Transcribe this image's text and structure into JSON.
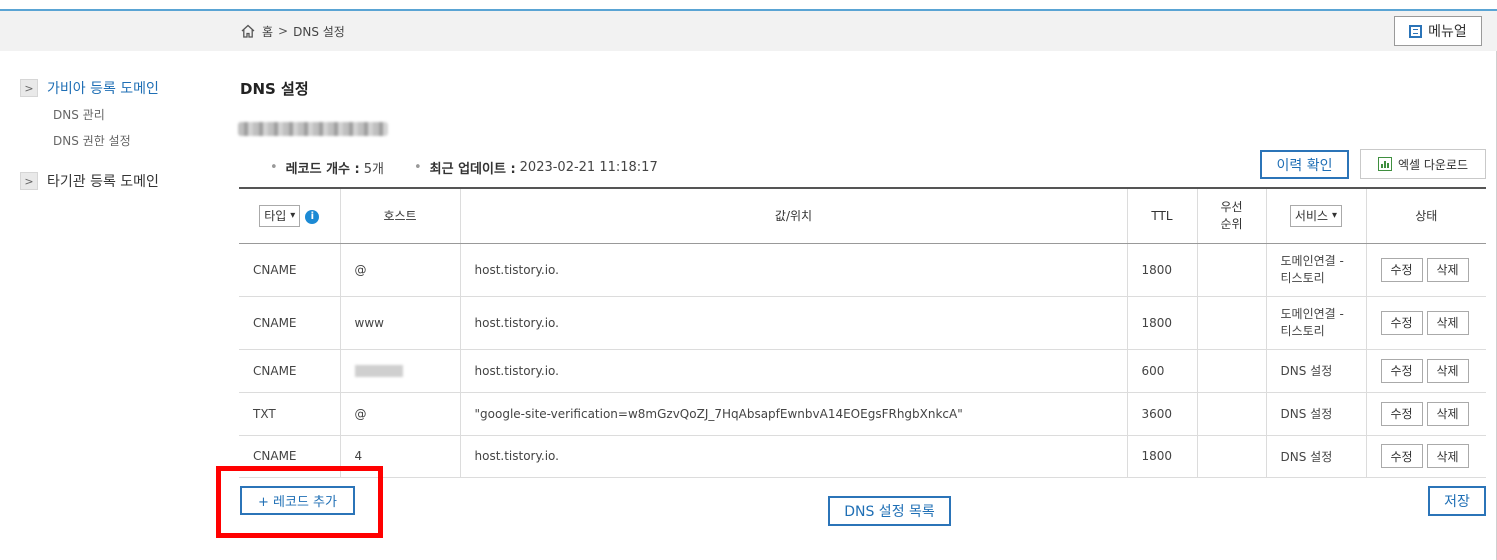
{
  "breadcrumb": {
    "home": "홈",
    "current": "DNS 설정",
    "separator": ">"
  },
  "header": {
    "manual_label": "메뉴얼"
  },
  "sidebar": {
    "sections": [
      {
        "label": "가비아 등록 도메인",
        "sub": [
          "DNS 관리",
          "DNS 권한 설정"
        ]
      },
      {
        "label": "타기관 등록 도메인"
      }
    ]
  },
  "page": {
    "title": "DNS 설정",
    "record_count_label": "레코드 개수 :",
    "record_count_value": "5개",
    "last_update_label": "최근 업데이트 :",
    "last_update_value": "2023-02-21 11:18:17",
    "history_button": "이력 확인",
    "excel_button": "엑셀 다운로드"
  },
  "table": {
    "headers": {
      "type_select": "타입",
      "host": "호스트",
      "value": "값/위치",
      "ttl": "TTL",
      "priority_line1": "우선",
      "priority_line2": "순위",
      "service_select": "서비스",
      "status": "상태"
    },
    "edit_label": "수정",
    "delete_label": "삭제",
    "rows": [
      {
        "type": "CNAME",
        "host": "@",
        "value": "host.tistory.io.",
        "ttl": "1800",
        "priority": "",
        "service_line1": "도메인연결 -",
        "service_line2": "티스토리"
      },
      {
        "type": "CNAME",
        "host": "www",
        "value": "host.tistory.io.",
        "ttl": "1800",
        "priority": "",
        "service_line1": "도메인연결 -",
        "service_line2": "티스토리"
      },
      {
        "type": "CNAME",
        "host": "",
        "value": "host.tistory.io.",
        "ttl": "600",
        "priority": "",
        "service_line1": "DNS 설정",
        "service_line2": ""
      },
      {
        "type": "TXT",
        "host": "@",
        "value": "\"google-site-verification=w8mGzvQoZJ_7HqAbsapfEwnbvA14EOEgsFRhgbXnkcA\"",
        "ttl": "3600",
        "priority": "",
        "service_line1": "DNS 설정",
        "service_line2": ""
      },
      {
        "type": "CNAME",
        "host": "4",
        "value": "host.tistory.io.",
        "ttl": "1800",
        "priority": "",
        "service_line1": "DNS 설정",
        "service_line2": ""
      }
    ]
  },
  "footer": {
    "add_record_button": "+ 레코드 추가",
    "dns_list_button": "DNS 설정 목록",
    "save_button": "저장"
  },
  "colors": {
    "accent": "#2b74b8",
    "highlight": "#ff0000"
  }
}
